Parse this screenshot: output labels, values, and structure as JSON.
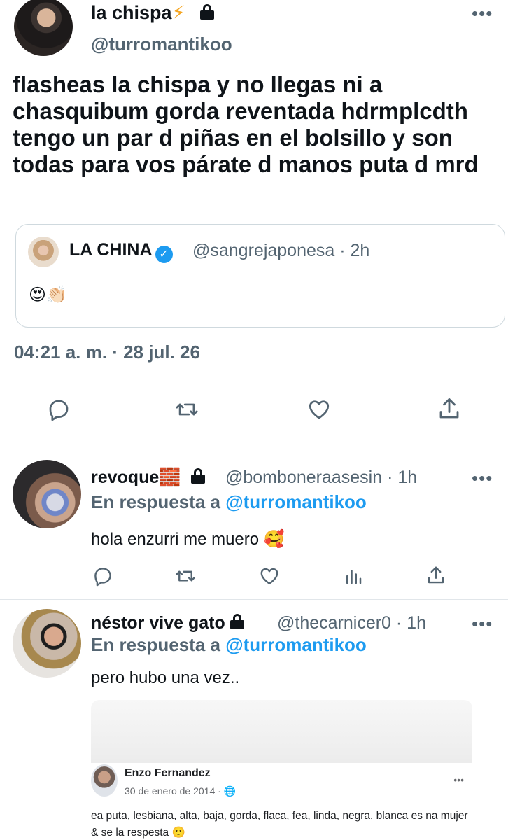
{
  "main_tweet": {
    "display_name": "la chispa",
    "name_emoji": "⚡",
    "handle": "@turromantikoo",
    "more": "•••",
    "text": "flasheas la chispa y no llegas ni a chasquibum gorda reventada hdrmplcdth tengo un par d piñas en el bolsillo y son todas para vos párate d manos puta d mrd",
    "timestamp": "04:21 a. m. · 28 jul. 26"
  },
  "quoted_tweet": {
    "display_name": "LA CHINA",
    "verified_glyph": "✓",
    "handle_time": "@sangrejaponesa · 2h",
    "emojis": "😍👏🏻"
  },
  "replies": [
    {
      "display_name": "revoque",
      "name_emoji": "🧱",
      "handle_time": "@bomboneraasesin · 1h",
      "more": "•••",
      "reply_prefix": "En respuesta a",
      "reply_mention": "@turromantikoo",
      "text": "hola enzurri me muero 🥰"
    },
    {
      "display_name": "néstor vive gato",
      "handle_time": "@thecarnicer0 · 1h",
      "more": "•••",
      "reply_prefix": "En respuesta a",
      "reply_mention": "@turromantikoo",
      "text": "pero hubo una vez..",
      "embed": {
        "author": "Enzo Fernandez",
        "date": "30 de enero de 2014 · 🌐",
        "more": "•••",
        "text": "ea puta, lesbiana, alta, baja, gorda, flaca, fea, linda, negra, blanca es na mujer & se la respesta 🙂"
      }
    }
  ],
  "icons": [
    "reply-icon",
    "retweet-icon",
    "like-icon",
    "share-icon",
    "analytics-icon",
    "lock-icon",
    "verified-icon"
  ],
  "colors": {
    "text": "#0f1419",
    "secondary": "#536471",
    "accent": "#1d9bf0",
    "border": "#cfd9de"
  }
}
